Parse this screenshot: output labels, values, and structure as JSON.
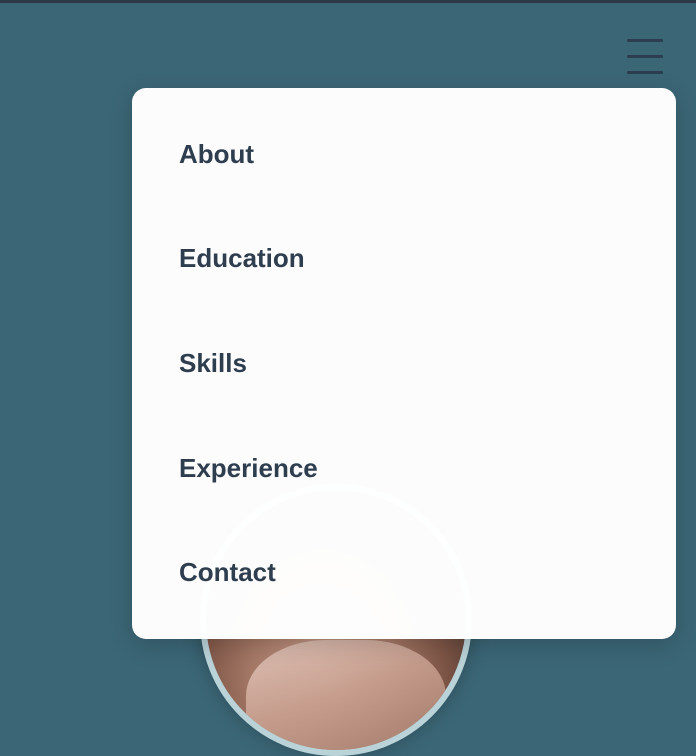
{
  "menu": {
    "items": [
      {
        "label": "About"
      },
      {
        "label": "Education"
      },
      {
        "label": "Skills"
      },
      {
        "label": "Experience"
      },
      {
        "label": "Contact"
      }
    ]
  },
  "hamburger": {
    "icon": "hamburger-menu-icon"
  },
  "avatar": {
    "icon": "profile-photo"
  },
  "colors": {
    "background": "#3b6676",
    "menu_text": "#2e3e4f",
    "panel": "#ffffff",
    "avatar_ring": "#b9d3d9"
  }
}
